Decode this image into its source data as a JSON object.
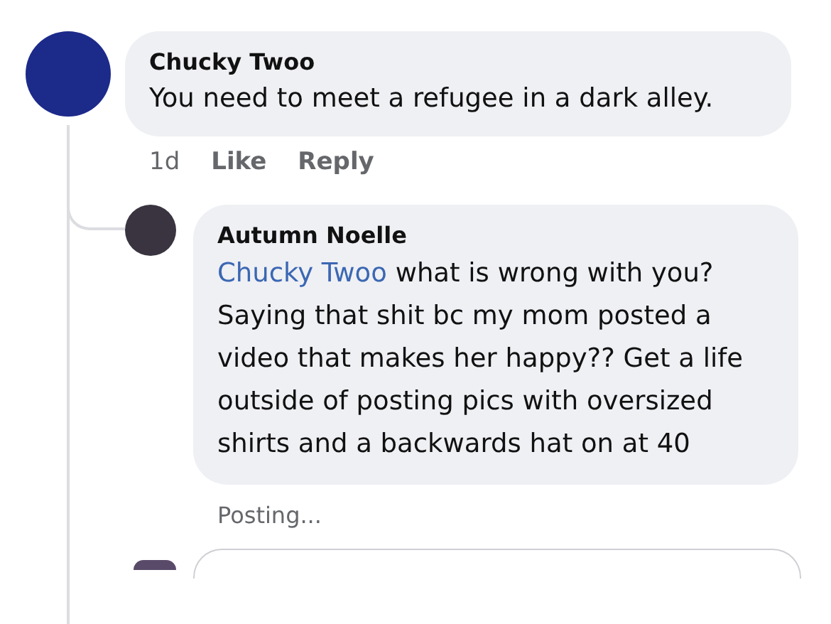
{
  "comment": {
    "author": "Chucky Twoo",
    "text": "You need to meet a refugee in a dark alley.",
    "time": "1d",
    "actions": [
      "Like",
      "Reply"
    ]
  },
  "reply": {
    "author": "Autumn Noelle",
    "mention": "Chucky Twoo",
    "text": "what is wrong with you? Saying that shit bc my mom posted a video that makes her happy?? Get a life outside of posting pics with oversized shirts and a backwards hat on at 40",
    "status": "Posting..."
  }
}
